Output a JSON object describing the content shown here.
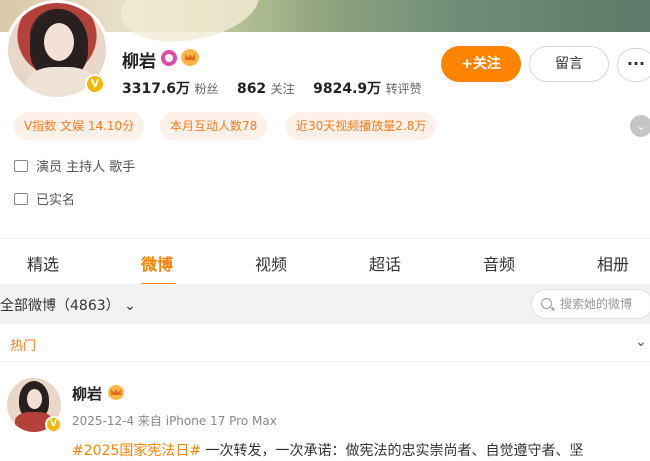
{
  "profile": {
    "name": "柳岩",
    "followers": "3317.6万",
    "followers_label": "粉丝",
    "following": "862",
    "following_label": "关注",
    "interactions": "9824.9万",
    "interactions_label": "转评赞",
    "verified_badge": "V"
  },
  "actions": {
    "follow_label": "+关注",
    "message_label": "留言",
    "more_label": "···"
  },
  "tags": [
    "V指数 文娱 14.10分",
    "本月互动人数78",
    "近30天视频播放量2.8万"
  ],
  "info": {
    "occupation": "演员 主持人 歌手",
    "verification": "已实名"
  },
  "tabs": [
    "精选",
    "微博",
    "视频",
    "超话",
    "音频",
    "相册"
  ],
  "active_tab": "微博",
  "filter": {
    "label": "全部微博（4863）",
    "search_placeholder": "搜索她的微博"
  },
  "hot": {
    "label": "热门"
  },
  "post": {
    "author": "柳岩",
    "meta": "2025-12-4 来自 iPhone 17 Pro Max",
    "topic": "#2025国家宪法日#",
    "text": " 一次转发，一次承诺：做宪法的忠实崇尚者、自觉遵守者、坚"
  },
  "colors": {
    "accent": "#ff8200",
    "tag_bg": "#fdf1e9",
    "verified": "#f5b800"
  },
  "icons": [
    "pink-badge-icon",
    "crown-icon",
    "actor-icon",
    "id-card-icon",
    "search-icon",
    "chevron-down-icon",
    "expand-icon"
  ]
}
